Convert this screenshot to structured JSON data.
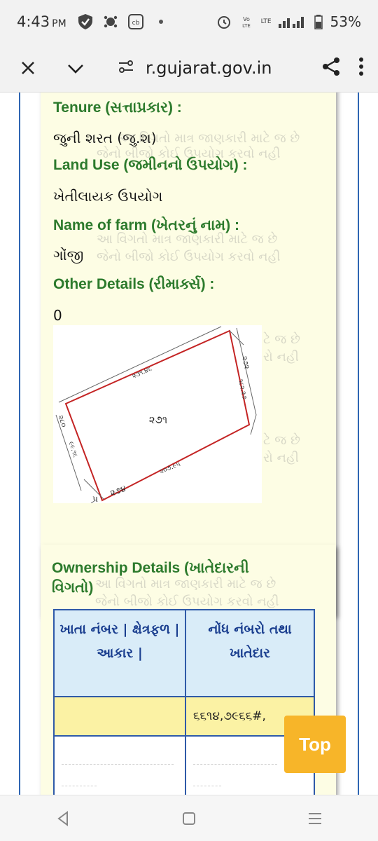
{
  "status_bar": {
    "time": "4:43",
    "ampm": "PM",
    "network_label": "LTE",
    "battery_percent": "53%",
    "icons": [
      "shield-check-icon",
      "settings-paw-icon",
      "cb-app-icon",
      "dot-icon",
      "alarm-icon",
      "volte-icon",
      "signal-icon",
      "battery-icon"
    ]
  },
  "browser": {
    "url": "r.gujarat.gov.in",
    "icons": [
      "close-icon",
      "chevron-down-icon",
      "site-settings-icon",
      "share-icon",
      "more-vert-icon"
    ]
  },
  "land_details": {
    "tenure_label": "Tenure (સત્તાપ્રકાર) :",
    "tenure_value": "જુની શરત (જુ.શ)",
    "land_use_label": "Land Use (જમીનનો ઉપયોગ) :",
    "land_use_value": "ખેતીલાયક ઉપયોગ",
    "farm_name_label": "Name of farm (ખેતરનું નામ) :",
    "farm_name_value": "ગોંજી",
    "other_details_label": "Other Details (રીમાર્ક્સ) :",
    "other_details_value": "0"
  },
  "watermark": {
    "line1": "આ વિગતો માત્ર જાણકારી માટે જ છે",
    "line2": "જેનો બીજો કોઈ ઉપયોગ કરવો નહી",
    "line1_cut": "ટે જ છે",
    "line2_cut": "રો નહી"
  },
  "map": {
    "plot_number": "૨૭૧",
    "edge_top": "૨૩૧.૪૬",
    "edge_right": "૧૮૨.૨૭",
    "edge_bottom": "૨૦૭.૯૫",
    "edge_left": "૯૯.૧૬",
    "corner_top_right": "૨૭૨",
    "corner_left": "૨૮૦",
    "corner_bottom": "૨૭૪",
    "corner_bottom_left": "પ"
  },
  "ownership": {
    "title": "Ownership Details (ખાતેદારની વિગતો)",
    "columns": [
      "ખાતા નંબર | ક્ષેત્રફળ | આકાર |",
      "નોંધ નંબરો તથા ખાતેદાર"
    ],
    "rows": [
      [
        "",
        "૬૬૧૪,૭૯૬૬#,"
      ],
      [
        "",
        ""
      ]
    ]
  },
  "top_button": {
    "label": "Top"
  },
  "nav": {
    "icons": [
      "back-icon",
      "home-icon",
      "recents-icon"
    ]
  },
  "colors": {
    "label_green": "#2c7a2c",
    "card_bg": "#fdfde4",
    "table_border": "#2f5aa8",
    "top_button": "#f7b529"
  }
}
